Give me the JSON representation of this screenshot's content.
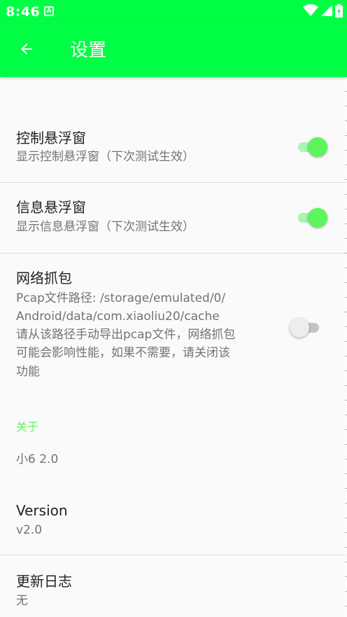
{
  "status_bar": {
    "time": "8:46",
    "notification_glyph": "A",
    "icons": [
      "wifi-icon",
      "signal-icon",
      "battery-icon"
    ]
  },
  "app_bar": {
    "title": "设置",
    "back_icon": "arrow-left-icon"
  },
  "prefs": {
    "control_float": {
      "title": "控制悬浮窗",
      "summary": "显示控制悬浮窗（下次测试生效）",
      "enabled": true
    },
    "info_float": {
      "title": "信息悬浮窗",
      "summary": "显示信息悬浮窗（下次测试生效）",
      "enabled": true
    },
    "packet_capture": {
      "title": "网络抓包",
      "summary_line1": "Pcap文件路径: /storage/emulated/0/",
      "summary_line2": "Android/data/com.xiaoliu20/cache",
      "summary_line3": "请从该路径手动导出pcap文件，网络抓包",
      "summary_line4": "可能会影响性能，如果不需要，请关闭该",
      "summary_line5": "功能",
      "enabled": false
    }
  },
  "about": {
    "category": "关于",
    "app_name": "小6 2.0",
    "version_title": "Version",
    "version_value": "v2.0",
    "changelog_title": "更新日志",
    "changelog_value": "无"
  },
  "colors": {
    "accent": "#00ff44",
    "switch_on": "#5cf55e",
    "category_text": "#5cf55e"
  }
}
